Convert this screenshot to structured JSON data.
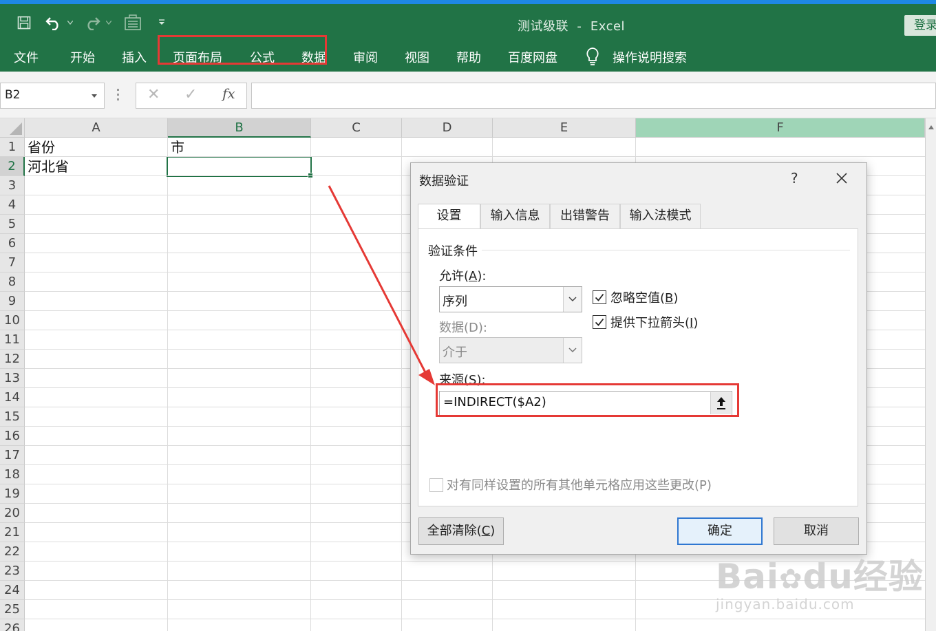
{
  "window": {
    "doc_name": "测试级联",
    "separator": "-",
    "app_name": "Excel",
    "login_label": "登录",
    "accent_color": "#217346"
  },
  "quick_access": {
    "icons": [
      "save-icon",
      "undo-icon",
      "redo-icon",
      "form-icon",
      "customize-qat-icon"
    ]
  },
  "ribbon": {
    "tabs": [
      "文件",
      "开始",
      "插入",
      "页面布局",
      "公式",
      "数据",
      "审阅",
      "视图",
      "帮助",
      "百度网盘"
    ],
    "search_label": "操作说明搜索"
  },
  "formula_bar": {
    "name_box": "B2",
    "cancel_glyph": "✕",
    "enter_glyph": "✓",
    "fx_label": "fx",
    "formula": ""
  },
  "sheet": {
    "columns": [
      "A",
      "B",
      "C",
      "D",
      "E",
      "F"
    ],
    "rows": [
      "1",
      "2",
      "3",
      "4",
      "5",
      "6",
      "7",
      "8",
      "9",
      "10",
      "11",
      "12",
      "13",
      "14",
      "15",
      "16",
      "17",
      "18",
      "19",
      "20",
      "21",
      "22",
      "23",
      "24",
      "25",
      "26"
    ],
    "cells": {
      "A1": "省份",
      "B1": "市",
      "A2": "河北省"
    },
    "selected_cell": "B2"
  },
  "dialog": {
    "title": "数据验证",
    "help_label": "?",
    "tabs": [
      "设置",
      "输入信息",
      "出错警告",
      "输入法模式"
    ],
    "group_label": "验证条件",
    "allow_label_prefix": "允许(",
    "allow_label_key": "A",
    "allow_label_suffix": "):",
    "allow_value": "序列",
    "data_label": "数据(D):",
    "data_value": "介于",
    "ignore_blank_prefix": "忽略空值(",
    "ignore_blank_key": "B",
    "ignore_blank_suffix": ")",
    "ignore_blank_checked": true,
    "dropdown_prefix": "提供下拉箭头(",
    "dropdown_key": "I",
    "dropdown_suffix": ")",
    "dropdown_checked": true,
    "source_label_prefix": "来源(",
    "source_label_key": "S",
    "source_label_suffix": "):",
    "source_value": "=INDIRECT($A2)",
    "apply_all_label": "对有同样设置的所有其他单元格应用这些更改(P)",
    "apply_all_checked": false,
    "clear_all_prefix": "全部清除(",
    "clear_all_key": "C",
    "clear_all_suffix": ")",
    "ok_label": "确定",
    "cancel_label": "取消"
  },
  "annotation": {
    "color": "#e53935"
  },
  "watermark": {
    "brand_a": "Bai",
    "brand_b": "du",
    "brand_c": "经验",
    "url": "jingyan.baidu.com"
  }
}
